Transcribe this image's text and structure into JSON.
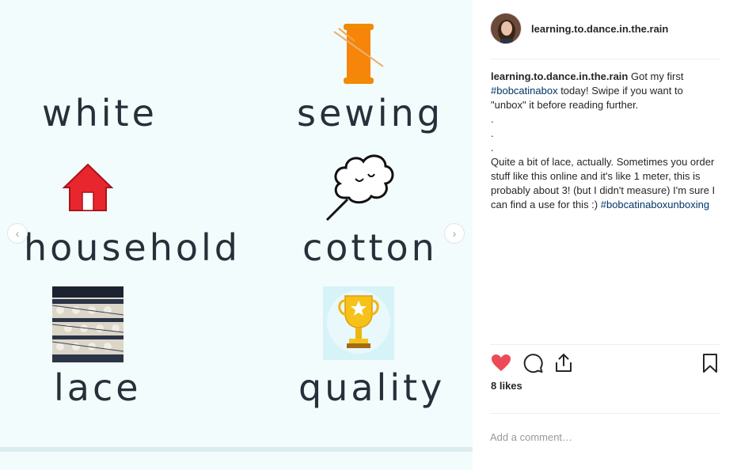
{
  "media": {
    "words": {
      "white": "white",
      "sewing": "sewing",
      "household": "household",
      "cotton": "cotton",
      "lace": "lace",
      "quality": "quality"
    },
    "icons": [
      "spool-icon",
      "house-icon",
      "cotton-icon",
      "lace-photo",
      "trophy-icon"
    ],
    "nav": {
      "prev": "‹",
      "next": "›"
    }
  },
  "post": {
    "username": "learning.to.dance.in.the.rain",
    "caption": {
      "username": "learning.to.dance.in.the.rain",
      "text_1": " Got my first ",
      "hashtag_1": "#bobcatinabox",
      "text_2": " today! Swipe if you want to \"unbox\" it before reading further.",
      "dots": [
        ".",
        ".",
        "."
      ],
      "text_3": "Quite a bit of lace, actually. Sometimes you order stuff like this online and it's like 1 meter, this is probably about 3! (but I didn't measure) I'm sure I can find a use for this :) ",
      "hashtag_2": "#bobcatinaboxunboxing"
    },
    "likes": "8 likes",
    "comment_placeholder": "Add a comment…"
  },
  "colors": {
    "like_red": "#ed4956",
    "hashtag_blue": "#003569",
    "image_bg": "#f3fcfc"
  }
}
